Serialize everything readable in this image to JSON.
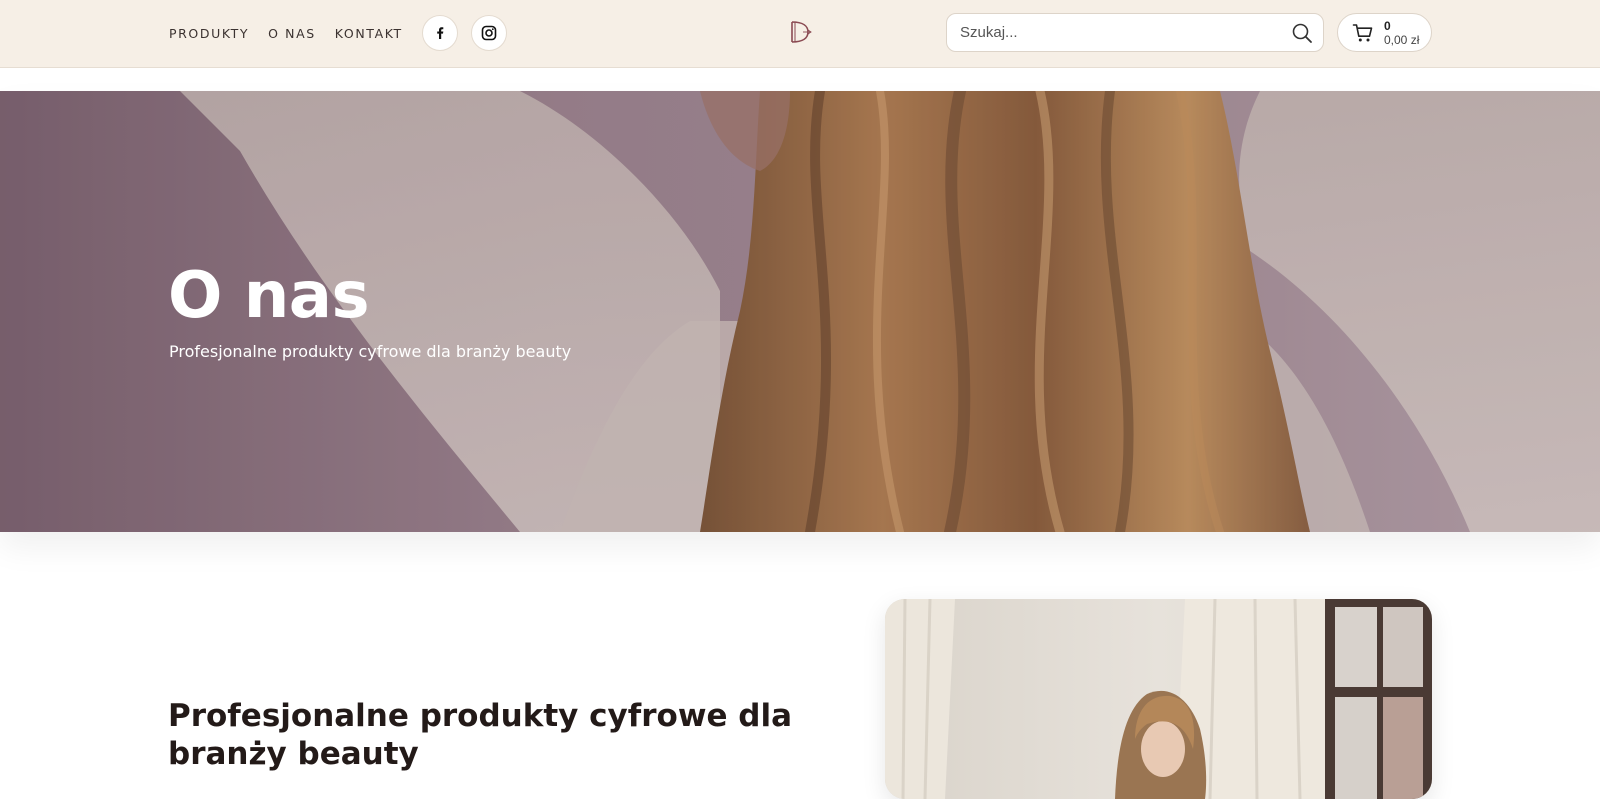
{
  "nav": {
    "items": [
      {
        "label": "PRODUKTY"
      },
      {
        "label": "O NAS"
      },
      {
        "label": "KONTAKT"
      }
    ],
    "social": [
      {
        "icon": "facebook-icon"
      },
      {
        "icon": "instagram-icon"
      }
    ]
  },
  "logo": {
    "icon": "brand-logo-icon"
  },
  "search": {
    "placeholder": "Szukaj...",
    "icon": "search-icon"
  },
  "cart": {
    "count": "0",
    "total": "0,00 zł",
    "icon": "cart-icon"
  },
  "hero": {
    "title": "O nas",
    "subtitle": "Profesjonalne produkty cyfrowe dla branży beauty"
  },
  "content": {
    "title": "Profesjonalne produkty cyfrowe dla branży beauty"
  },
  "colors": {
    "header_bg": "#f6efe6",
    "text_dark": "#231a18",
    "logo_accent": "#8a4a52"
  }
}
